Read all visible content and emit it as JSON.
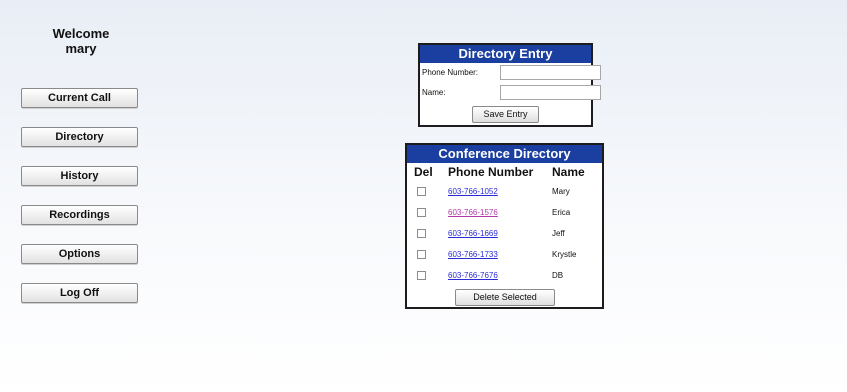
{
  "user": {
    "welcome_label": "Welcome",
    "username": "mary"
  },
  "nav": {
    "items": [
      {
        "label": "Current Call"
      },
      {
        "label": "Directory"
      },
      {
        "label": "History"
      },
      {
        "label": "Recordings"
      },
      {
        "label": "Options"
      },
      {
        "label": "Log Off"
      }
    ]
  },
  "directory_entry": {
    "title": "Directory Entry",
    "phone_label": "Phone Number:",
    "phone_value": "",
    "name_label": "Name:",
    "name_value": "",
    "save_label": "Save Entry"
  },
  "conference_directory": {
    "title": "Conference Directory",
    "columns": {
      "del": "Del",
      "phone": "Phone Number",
      "name": "Name"
    },
    "rows": [
      {
        "phone": "603-766-1052",
        "name": "Mary",
        "visited": false,
        "checked": false
      },
      {
        "phone": "603-766-1576",
        "name": "Erica",
        "visited": true,
        "checked": false
      },
      {
        "phone": "603-766-1669",
        "name": "Jeff",
        "visited": false,
        "checked": false
      },
      {
        "phone": "603-766-1733",
        "name": "Krystle",
        "visited": false,
        "checked": false
      },
      {
        "phone": "603-766-7676",
        "name": "DB",
        "visited": false,
        "checked": false
      }
    ],
    "delete_label": "Delete Selected"
  },
  "colors": {
    "header_bg": "#1b3fa0",
    "link": "#2b2bd6",
    "link_visited": "#b03aa8"
  }
}
